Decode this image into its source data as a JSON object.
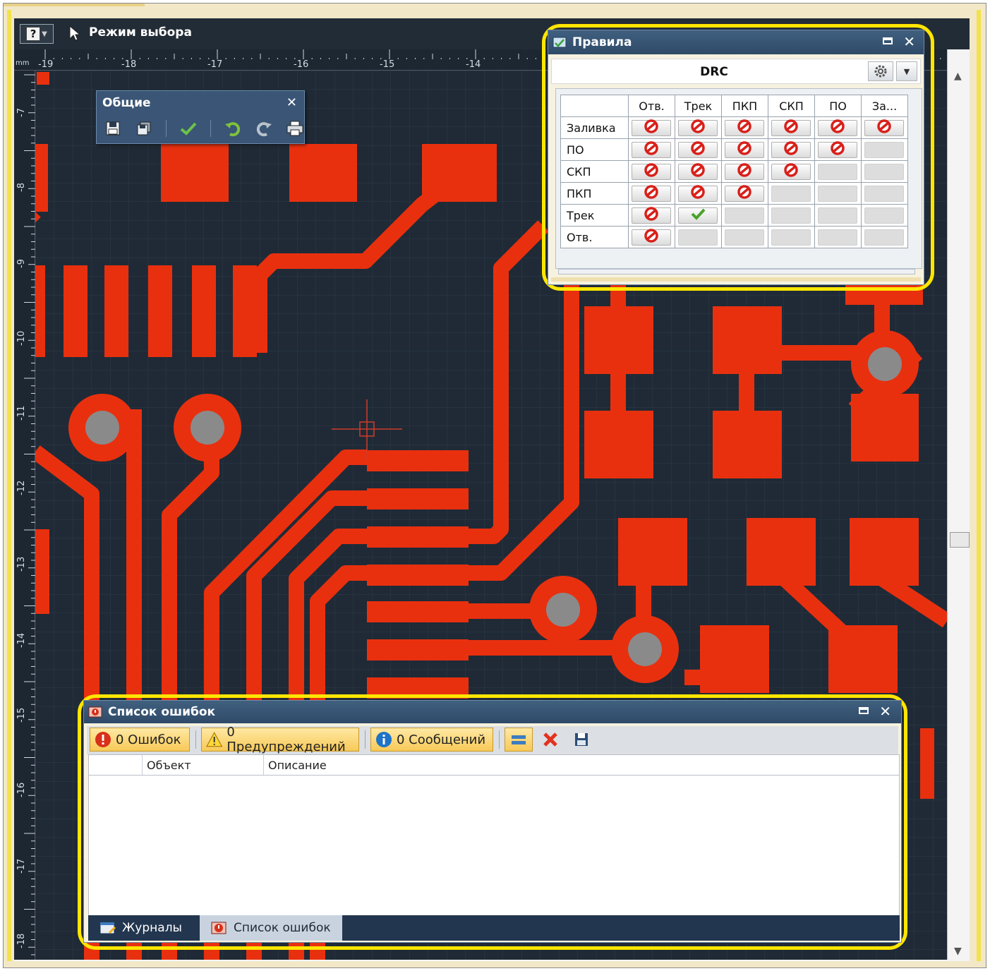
{
  "topbar": {
    "mode_button_glyph": "?",
    "mode_label": "Режим выбора"
  },
  "rulers": {
    "unit": "mm",
    "x_ticks": [
      "-19",
      "-18",
      "-17",
      "-16",
      "-15",
      "-14"
    ],
    "y_ticks": [
      "-7",
      "-8",
      "-9",
      "-10",
      "-11",
      "-12",
      "-13",
      "-14",
      "-15",
      "-16",
      "-17",
      "-18"
    ]
  },
  "general_toolbar": {
    "title": "Общие",
    "close_glyph": "✕",
    "buttons": [
      "save-icon",
      "save-all-icon",
      "checkmark-icon",
      "undo-icon",
      "redo-icon",
      "print-icon"
    ]
  },
  "rules_panel": {
    "title": "Правила",
    "mode": "DRC",
    "columns": [
      "Отв.",
      "Трек",
      "ПКП",
      "СКП",
      "ПО",
      "За..."
    ],
    "rows": [
      {
        "label": "Заливка",
        "cells": [
          "forbid",
          "forbid",
          "forbid",
          "forbid",
          "forbid",
          "forbid"
        ]
      },
      {
        "label": "ПО",
        "cells": [
          "forbid",
          "forbid",
          "forbid",
          "forbid",
          "forbid",
          "empty"
        ]
      },
      {
        "label": "СКП",
        "cells": [
          "forbid",
          "forbid",
          "forbid",
          "forbid",
          "empty",
          "empty"
        ]
      },
      {
        "label": "ПКП",
        "cells": [
          "forbid",
          "forbid",
          "forbid",
          "empty",
          "empty",
          "empty"
        ]
      },
      {
        "label": "Трек",
        "cells": [
          "forbid",
          "allow",
          "empty",
          "empty",
          "empty",
          "empty"
        ]
      },
      {
        "label": "Отв.",
        "cells": [
          "forbid",
          "empty",
          "empty",
          "empty",
          "empty",
          "empty"
        ]
      }
    ]
  },
  "error_panel": {
    "title": "Список ошибок",
    "filters": {
      "errors": "0 Ошибок",
      "warnings": "0 Предупреждений",
      "messages": "0 Сообщений"
    },
    "columns": [
      "",
      "Объект",
      "Описание"
    ],
    "rows": [],
    "tabs": [
      "Журналы",
      "Список ошибок"
    ],
    "active_tab": "Список ошибок"
  },
  "colors": {
    "board_bg": "#1f2a36",
    "copper": "#e8300f",
    "drill": "#8a8a8a",
    "highlight": "#ffe600",
    "panel_header": "#35506f"
  }
}
